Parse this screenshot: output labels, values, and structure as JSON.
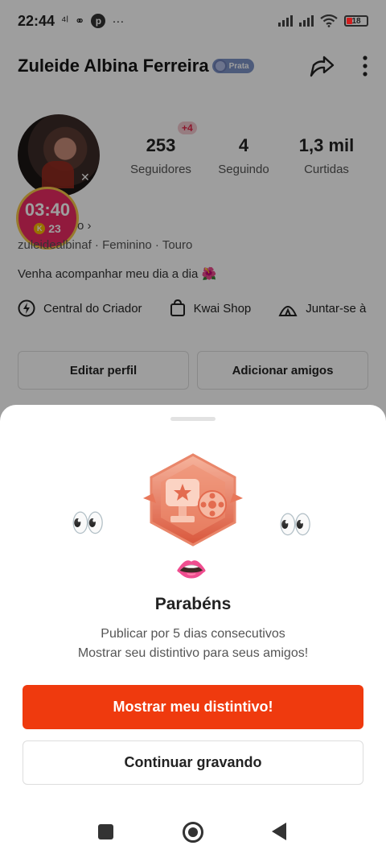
{
  "status_bar": {
    "time": "22:44",
    "battery": "18",
    "icons": [
      "signal-icon",
      "wifi-icon",
      "battery-icon"
    ]
  },
  "profile": {
    "username": "Zuleide Albina Ferreira",
    "rank_label": "Prata",
    "stats": {
      "followers_count": "253",
      "followers_label": "Seguidores",
      "followers_new": "+4",
      "following_count": "4",
      "following_label": "Seguindo",
      "likes_count": "1,3 mil",
      "likes_label": "Curtidas"
    },
    "timer": "03:40",
    "coins": "23",
    "more_link": "o ›",
    "meta": "zuleidealbinaf · Feminino · Touro",
    "bio": "Venha acompanhar meu dia a dia 🌺",
    "shortcuts": [
      "Central do Criador",
      "Kwai Shop",
      "Juntar-se à"
    ],
    "edit_profile": "Editar perfil",
    "add_friends": "Adicionar amigos"
  },
  "sheet": {
    "eyes": "👀",
    "mouth": "👄",
    "title": "Parabéns",
    "line1": "Publicar por 5 dias consecutivos",
    "line2": "Mostrar seu distintivo para seus amigos!",
    "primary_button": "Mostrar meu distintivo!",
    "secondary_button": "Continuar gravando"
  },
  "colors": {
    "primary": "#ef3a0e",
    "badge_orange": "#e6785c",
    "timer_pink": "#ea2a63"
  }
}
